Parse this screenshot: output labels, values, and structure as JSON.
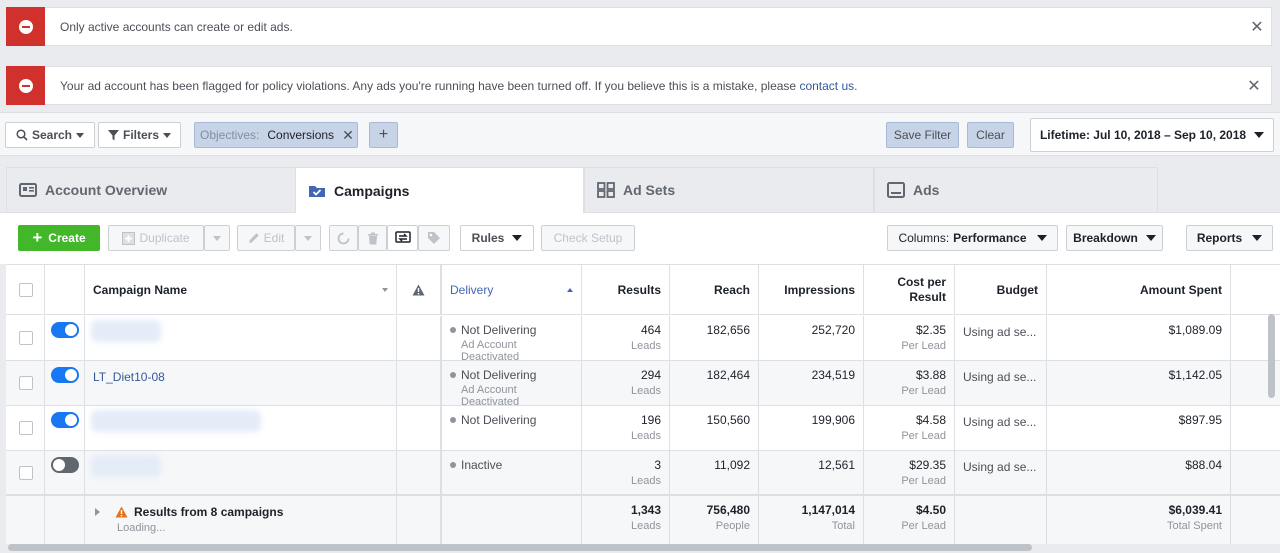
{
  "alerts": [
    {
      "text": "Only active accounts can create or edit ads.",
      "link": "",
      "tail": ""
    },
    {
      "text": "Your ad account has been flagged for policy violations. Any ads you're running have been turned off. If you believe this is a mistake, please ",
      "link": "contact us",
      "tail": "."
    }
  ],
  "filterbar": {
    "search": "Search",
    "filters": "Filters",
    "chip_key": "Objectives:",
    "chip_value": "Conversions",
    "add": "+",
    "save_filter": "Save Filter",
    "clear": "Clear",
    "date_range": "Lifetime: Jul 10, 2018 – Sep 10, 2018"
  },
  "tabs": [
    {
      "label": "Account Overview",
      "icon": "account-overview-icon"
    },
    {
      "label": "Campaigns",
      "icon": "folder-check-icon"
    },
    {
      "label": "Ad Sets",
      "icon": "grid-icon"
    },
    {
      "label": "Ads",
      "icon": "ad-display-icon"
    }
  ],
  "toolbar": {
    "create": "Create",
    "duplicate": "Duplicate",
    "edit": "Edit",
    "rules": "Rules",
    "check_setup": "Check Setup",
    "columns_prefix": "Columns:",
    "columns_value": "Performance",
    "breakdown": "Breakdown",
    "reports": "Reports"
  },
  "table": {
    "headers": {
      "campaign_name": "Campaign Name",
      "delivery": "Delivery",
      "results": "Results",
      "reach": "Reach",
      "impressions": "Impressions",
      "cost_per_result_1": "Cost per",
      "cost_per_result_2": "Result",
      "budget": "Budget",
      "amount_spent": "Amount Spent"
    },
    "rows": [
      {
        "name": "",
        "on": true,
        "status": "Not Delivering",
        "status_sub": "Ad Account Deactivated",
        "results": "464",
        "results_sub": "Leads",
        "reach": "182,656",
        "impressions": "252,720",
        "cost": "$2.35",
        "cost_sub": "Per Lead",
        "budget": "Using ad se...",
        "spent": "$1,089.09"
      },
      {
        "name": "LT_Diet10-08",
        "on": true,
        "status": "Not Delivering",
        "status_sub": "Ad Account Deactivated",
        "results": "294",
        "results_sub": "Leads",
        "reach": "182,464",
        "impressions": "234,519",
        "cost": "$3.88",
        "cost_sub": "Per Lead",
        "budget": "Using ad se...",
        "spent": "$1,142.05"
      },
      {
        "name": "",
        "on": true,
        "status": "Not Delivering",
        "status_sub": "",
        "results": "196",
        "results_sub": "Leads",
        "reach": "150,560",
        "impressions": "199,906",
        "cost": "$4.58",
        "cost_sub": "Per Lead",
        "budget": "Using ad se...",
        "spent": "$897.95"
      },
      {
        "name": "",
        "on": false,
        "status": "Inactive",
        "status_sub": "",
        "results": "3",
        "results_sub": "Leads",
        "reach": "11,092",
        "impressions": "12,561",
        "cost": "$29.35",
        "cost_sub": "Per Lead",
        "budget": "Using ad se...",
        "spent": "$88.04"
      }
    ],
    "summary": {
      "label": "Results from 8 campaigns",
      "loading": "Loading...",
      "results": "1,343",
      "results_sub": "Leads",
      "reach": "756,480",
      "reach_sub": "People",
      "impressions": "1,147,014",
      "impressions_sub": "Total",
      "cost": "$4.50",
      "cost_sub": "Per Lead",
      "spent": "$6,039.41",
      "spent_sub": "Total Spent"
    }
  },
  "colors": {
    "alert_red": "#d0312d",
    "create_green": "#42b72a",
    "toggle_blue": "#1877f2",
    "link_blue": "#365899"
  }
}
